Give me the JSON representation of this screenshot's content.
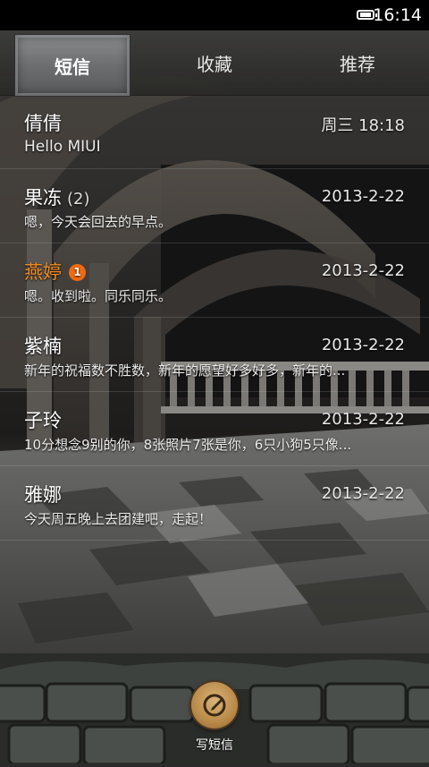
{
  "status": {
    "time": "16:14",
    "battery_icon": "battery-icon"
  },
  "tabs": [
    {
      "label": "短信",
      "active": true
    },
    {
      "label": "收藏",
      "active": false
    },
    {
      "label": "推荐",
      "active": false
    }
  ],
  "conversations": [
    {
      "name": "倩倩",
      "count": "",
      "badge": "",
      "date": "周三 18:18",
      "preview": "Hello MIUI",
      "unread": false
    },
    {
      "name": "果冻",
      "count": "(2)",
      "badge": "",
      "date": "2013-2-22",
      "preview": "嗯，今天会回去的早点。",
      "unread": false
    },
    {
      "name": "燕婷",
      "count": "",
      "badge": "1",
      "date": "2013-2-22",
      "preview": "嗯。收到啦。同乐同乐。",
      "unread": true
    },
    {
      "name": "紫楠",
      "count": "",
      "badge": "",
      "date": "2013-2-22",
      "preview": "新年的祝福数不胜数，新年的愿望好多好多，新年的...",
      "unread": false
    },
    {
      "name": "子玲",
      "count": "",
      "badge": "",
      "date": "2013-2-22",
      "preview": "10分想念9别的你，8张照片7张是你，6只小狗5只像...",
      "unread": false
    },
    {
      "name": "雅娜",
      "count": "",
      "badge": "",
      "date": "2013-2-22",
      "preview": "今天周五晚上去团建吧，走起！",
      "unread": false
    }
  ],
  "compose": {
    "label": "写短信",
    "icon": "compose-icon"
  },
  "colors": {
    "unread_name": "#f08a1f",
    "badge": "#f06a10"
  }
}
